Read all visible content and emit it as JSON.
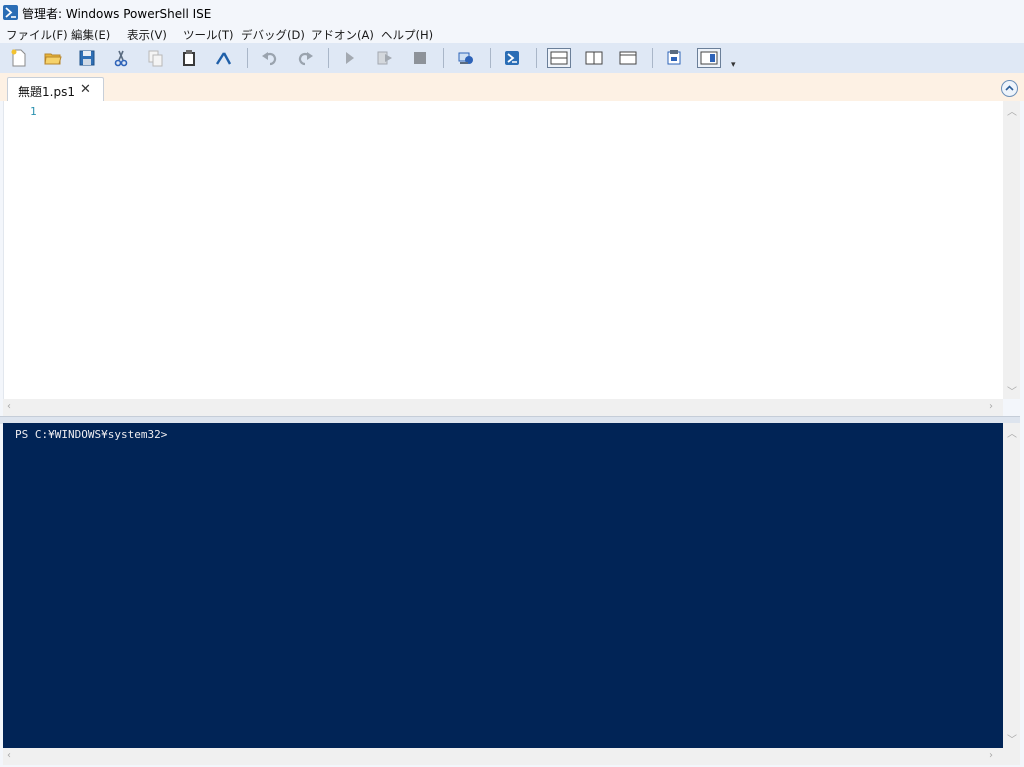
{
  "window": {
    "title": "管理者: Windows PowerShell ISE"
  },
  "menu": [
    {
      "label": "ファイル(F)"
    },
    {
      "label": "編集(E)"
    },
    {
      "label": "表示(V)"
    },
    {
      "label": "ツール(T)"
    },
    {
      "label": "デバッグ(D)"
    },
    {
      "label": "アドオン(A)"
    },
    {
      "label": "ヘルプ(H)"
    }
  ],
  "toolbar": {
    "buttons": [
      {
        "icon": "new-file-icon"
      },
      {
        "icon": "open-folder-icon"
      },
      {
        "icon": "save-icon"
      },
      {
        "icon": "cut-icon"
      },
      {
        "icon": "copy-icon"
      },
      {
        "icon": "paste-icon"
      },
      {
        "icon": "clear-console-icon"
      },
      {
        "icon": "undo-icon"
      },
      {
        "icon": "redo-icon"
      },
      {
        "icon": "run-script-icon"
      },
      {
        "icon": "run-selection-icon"
      },
      {
        "icon": "stop-icon"
      },
      {
        "icon": "new-remote-tab-icon"
      },
      {
        "icon": "powershell-console-icon"
      },
      {
        "icon": "show-script-top-icon"
      },
      {
        "icon": "show-script-right-icon"
      },
      {
        "icon": "show-script-maximized-icon"
      },
      {
        "icon": "show-command-window-icon"
      },
      {
        "icon": "show-command-addon-icon"
      }
    ],
    "overflow": "▾"
  },
  "tabs": [
    {
      "label": "無題1.ps1",
      "close": "✕"
    }
  ],
  "editor": {
    "line_numbers": [
      "1"
    ]
  },
  "console": {
    "prompt": "PS C:¥WINDOWS¥system32>"
  },
  "colors": {
    "console_background": "#012456",
    "console_text": "#eeedf0",
    "line_number": "#2b91af",
    "tabstrip": "#fdf1e4",
    "toolbar": "#dfe8f5"
  }
}
